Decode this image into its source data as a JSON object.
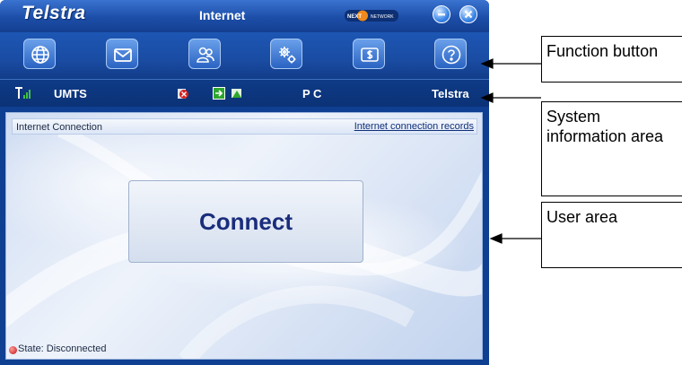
{
  "window": {
    "brand": "Telstra",
    "title": "Internet",
    "nextg_logo_text": "NEXT G NETWORK"
  },
  "function_buttons": [
    {
      "name": "internet",
      "icon": "globe-icon"
    },
    {
      "name": "messages",
      "icon": "envelope-icon"
    },
    {
      "name": "contacts",
      "icon": "contacts-icon"
    },
    {
      "name": "settings",
      "icon": "gears-icon"
    },
    {
      "name": "usage",
      "icon": "dollar-icon"
    },
    {
      "name": "help",
      "icon": "question-icon"
    }
  ],
  "status": {
    "network_type": "UMTS",
    "device_mode": "P C",
    "operator": "Telstra"
  },
  "user_area": {
    "title": "Internet Connection",
    "records_link": "Internet connection records",
    "connect_label": "Connect",
    "state_text": "State: Disconnected"
  },
  "callouts": {
    "function": "Function button",
    "system": "System information area",
    "user": "User area"
  },
  "colors": {
    "window_blue": "#1a4ca3",
    "connect_text": "#1a2d7c",
    "state_disconnected": "#c01010"
  }
}
